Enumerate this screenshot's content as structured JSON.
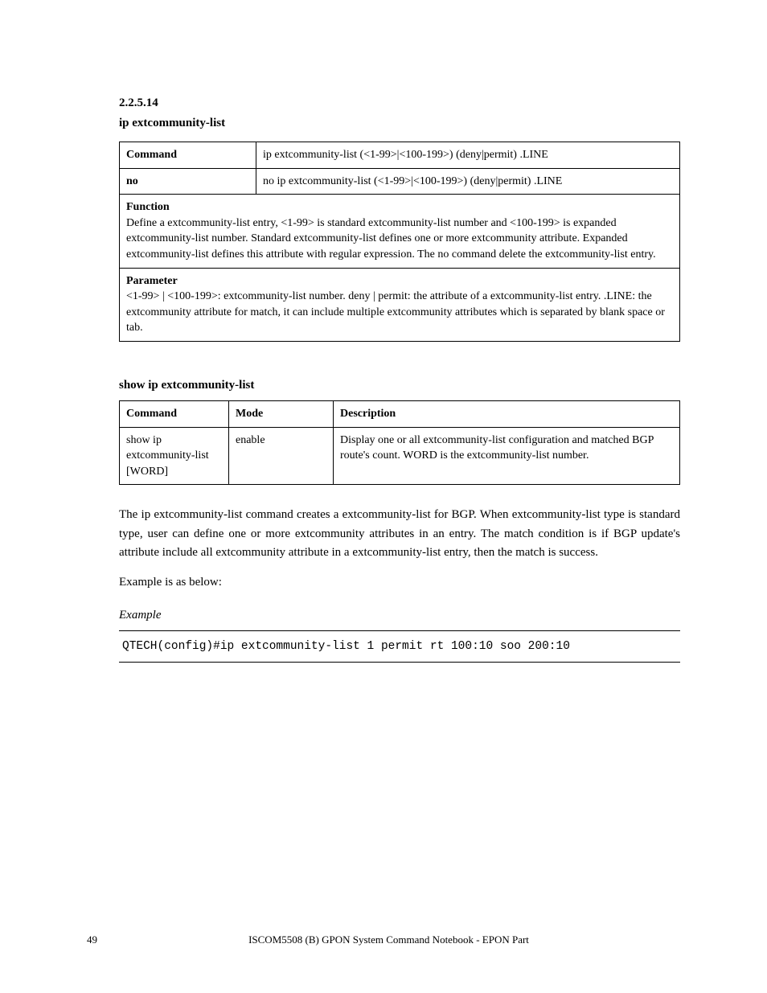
{
  "section": {
    "number": "2.2.5.14",
    "title": "ip extcommunity-list"
  },
  "table1": {
    "rows": [
      {
        "label": "Command",
        "value": "ip extcommunity-list (<1-99>|<100-199>) (deny|permit) .LINE"
      },
      {
        "label": "no",
        "value": "no ip extcommunity-list (<1-99>|<100-199>) (deny|permit) .LINE"
      }
    ],
    "func": {
      "label": "Function",
      "text": "Define a extcommunity-list entry, <1-99> is standard extcommunity-list number and <100-199> is expanded extcommunity-list number. Standard extcommunity-list defines one or more extcommunity attribute. Expanded extcommunity-list defines this attribute with regular expression. The no command delete the extcommunity-list entry."
    },
    "param": {
      "label": "Parameter",
      "text": "<1-99> | <100-199>: extcommunity-list number. deny | permit: the attribute of a extcommunity-list entry. .LINE: the extcommunity attribute for match, it can include multiple extcommunity attributes which is separated by blank space or tab."
    }
  },
  "caption2": "show ip extcommunity-list",
  "table2": {
    "header": {
      "c1": "Command",
      "c2": "Mode",
      "c3": "Description"
    },
    "row": {
      "c1": "show ip extcommunity-list [WORD]",
      "c2": "enable",
      "c3": "Display one or all extcommunity-list configuration and matched BGP route's count. WORD is the extcommunity-list number."
    }
  },
  "body": {
    "p1": "The ip extcommunity-list command creates a extcommunity-list for BGP. When extcommunity-list type is standard type, user can define one or more extcommunity attributes in an entry. The match condition is if BGP update's attribute include all extcommunity attribute in a extcommunity-list entry, then the match is success.",
    "p2": "Example is as below:"
  },
  "example": {
    "label": "Example",
    "cli": "QTECH(config)#ip extcommunity-list 1 permit rt 100:10 soo 200:10"
  },
  "footer": {
    "left": "49",
    "center": "ISCOM5508 (B) GPON System Command Notebook - EPON Part",
    "right": ""
  }
}
